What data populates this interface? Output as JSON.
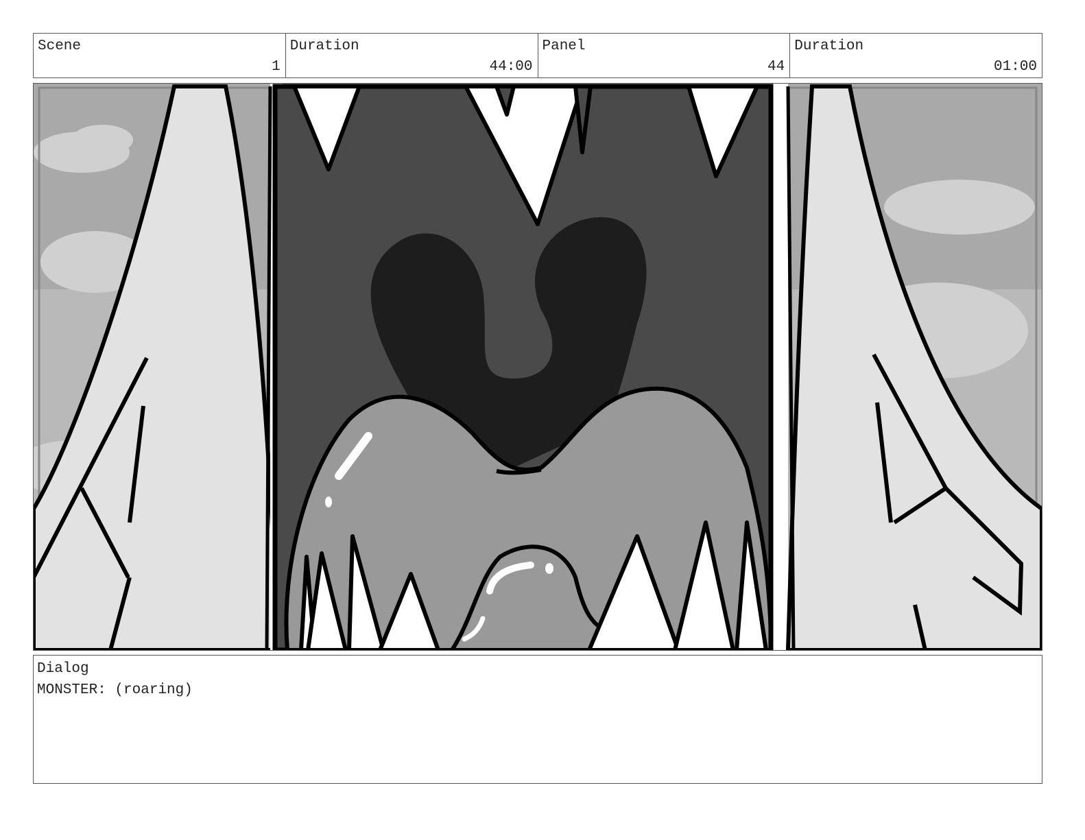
{
  "header": {
    "scene_label": "Scene",
    "scene_value": "1",
    "scene_duration_label": "Duration",
    "scene_duration_value": "44:00",
    "panel_label": "Panel",
    "panel_value": "44",
    "panel_duration_label": "Duration",
    "panel_duration_value": "01:00"
  },
  "dialog": {
    "label": "Dialog",
    "text": "MONSTER: (roaring)"
  }
}
